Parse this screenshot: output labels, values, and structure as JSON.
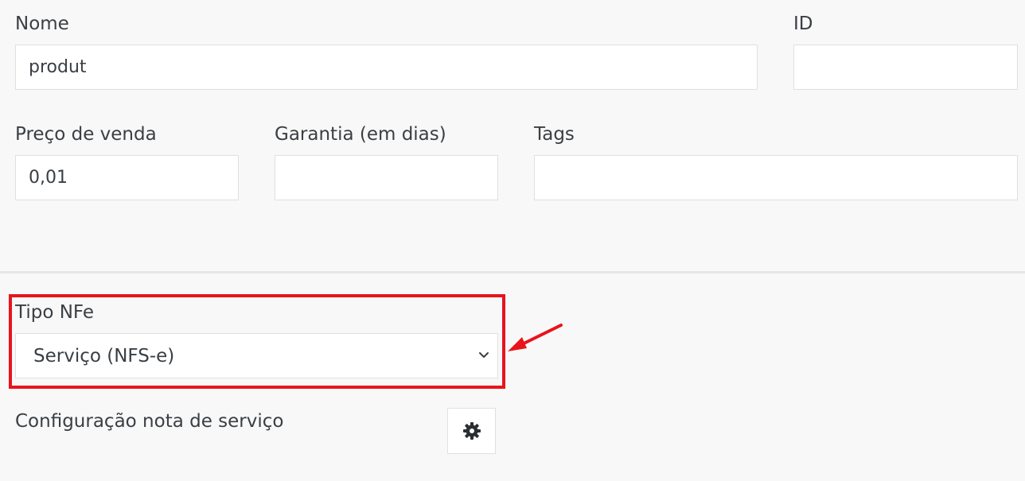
{
  "form": {
    "nome": {
      "label": "Nome",
      "value": "produt"
    },
    "id": {
      "label": "ID",
      "value": ""
    },
    "preco": {
      "label": "Preço de venda",
      "value": "0,01"
    },
    "garantia": {
      "label": "Garantia (em dias)",
      "value": ""
    },
    "tags": {
      "label": "Tags",
      "value": ""
    },
    "tipo_nfe": {
      "label": "Tipo NFe",
      "selected": "Serviço (NFS-e)"
    },
    "config_nota": {
      "label": "Configuração nota de serviço",
      "button_icon": "gear-icon"
    }
  },
  "annotation": {
    "highlight_color": "#e8141c",
    "arrow_icon": "arrow-icon"
  }
}
